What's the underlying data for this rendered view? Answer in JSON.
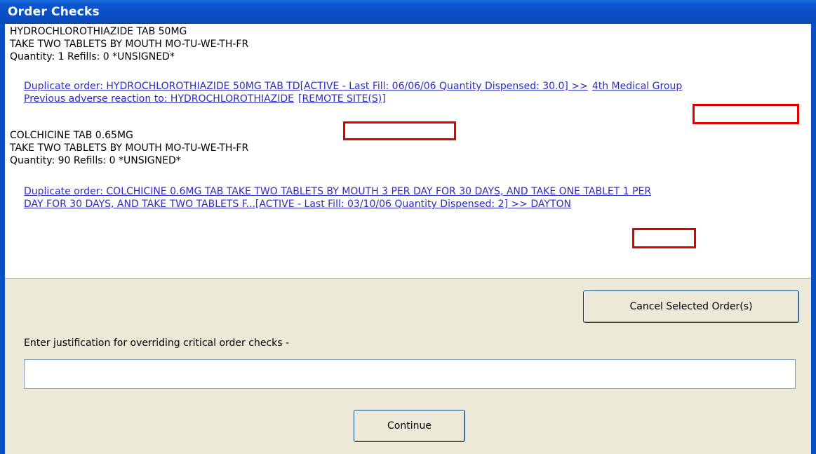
{
  "window": {
    "title": "Order Checks"
  },
  "orders": [
    {
      "lines": [
        "HYDROCHLOROTHIAZIDE TAB  50MG",
        "TAKE TWO TABLETS BY MOUTH MO-TU-WE-TH-FR",
        "Quantity: 1 Refills: 0 *UNSIGNED*"
      ],
      "checks": [
        {
          "text": "Duplicate order: HYDROCHLOROTHIAZIDE 50MG TAB TD[ACTIVE -   Last Fill: 06/06/06   Quantity Dispensed: 30.0] >>",
          "site": "4th Medical Group"
        },
        {
          "text": "Previous adverse reaction to: HYDROCHLOROTHIAZIDE",
          "site": "[REMOTE SITE(S)]"
        }
      ]
    },
    {
      "lines": [
        "COLCHICINE TAB  0.65MG",
        "TAKE TWO TABLETS BY MOUTH MO-TU-WE-TH-FR",
        "Quantity: 90 Refills: 0 *UNSIGNED*"
      ],
      "checks": [
        {
          "text": "Duplicate order: COLCHICINE 0.6MG TAB TAKE TWO TABLETS BY MOUTH 3 PER DAY FOR 30 DAYS, AND TAKE ONE TABLET 1 PER",
          "text2": "DAY FOR 30 DAYS, AND TAKE TWO TABLETS F...[ACTIVE -   Last Fill: 03/10/06   Quantity Dispensed: 2] >>",
          "site": " DAYTON"
        }
      ]
    }
  ],
  "buttons": {
    "cancel_label": "Cancel Selected Order(s)",
    "continue_label": "Continue"
  },
  "justification": {
    "label": "Enter justification for overriding critical order checks -",
    "value": ""
  },
  "colors": {
    "title_bar": "#0a4fc4",
    "link": "#2b2bc8",
    "highlight": "#e00000",
    "dialog_bg": "#ece9d8"
  }
}
